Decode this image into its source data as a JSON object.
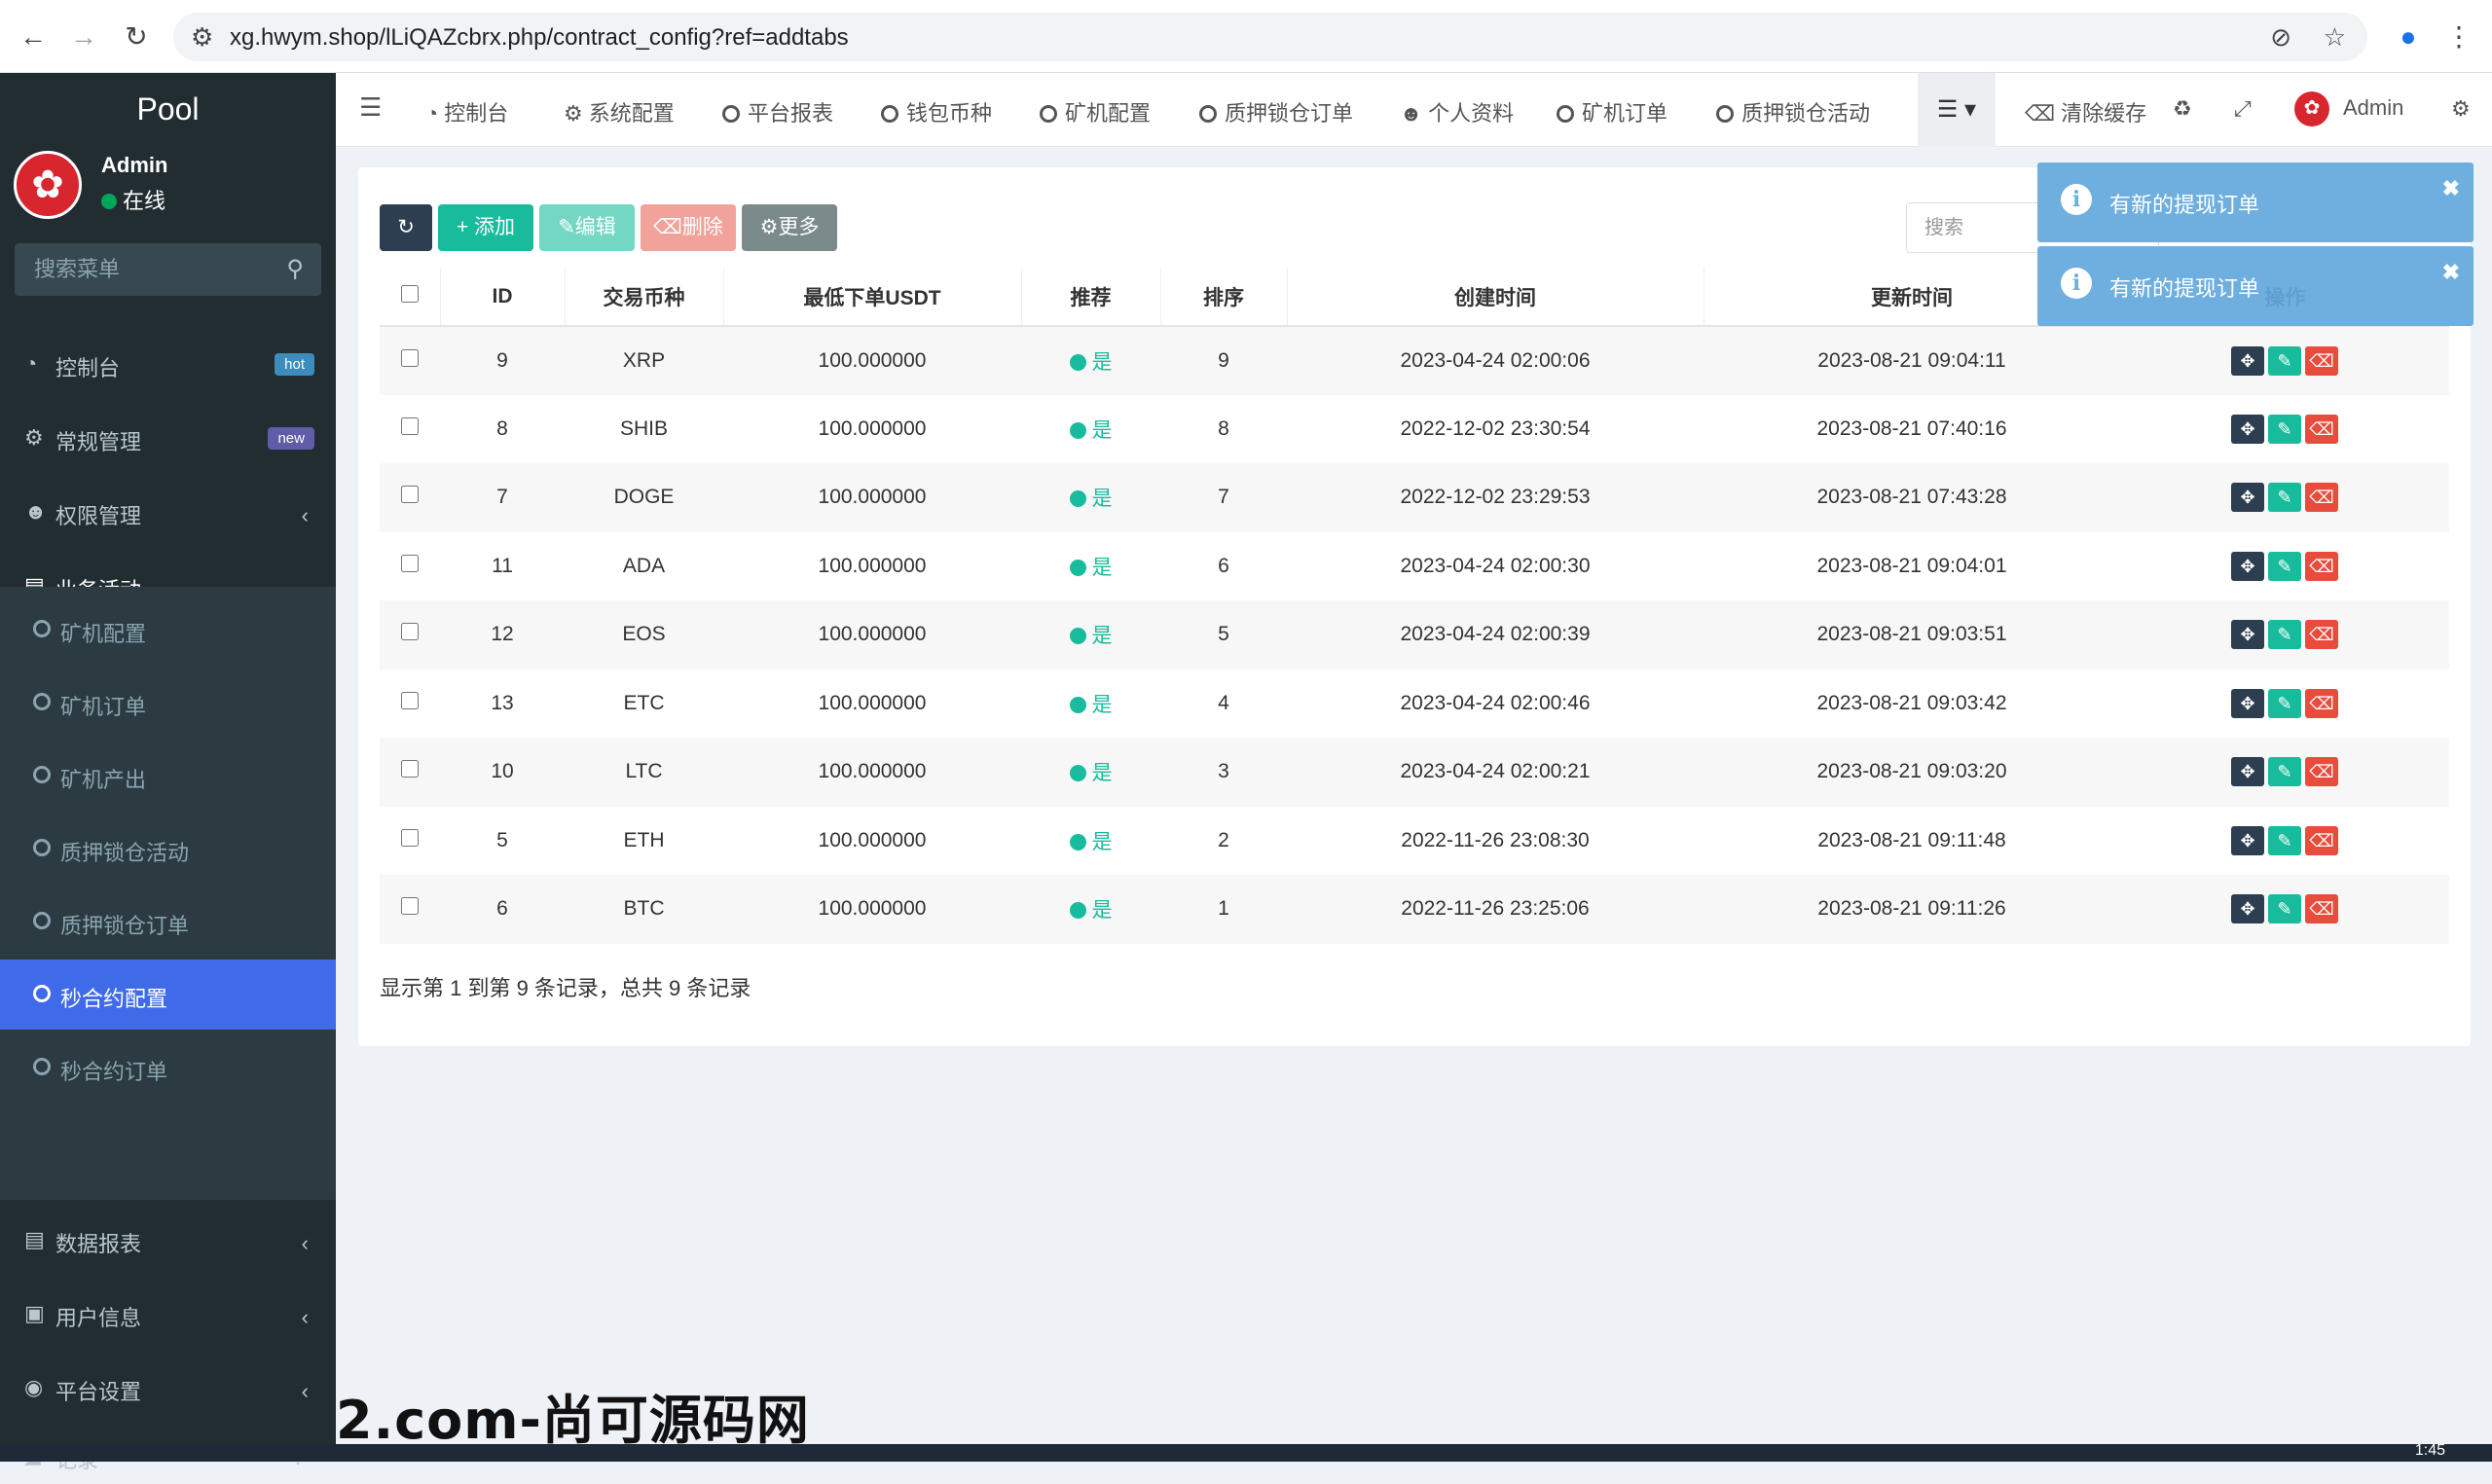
{
  "browser": {
    "url": "xg.hwym.shop/lLiQAZcbrx.php/contract_config?ref=addtabs"
  },
  "sidebar": {
    "logo": "Pool",
    "user": {
      "name": "Admin",
      "status": "在线"
    },
    "search_placeholder": "搜索菜单",
    "menu": [
      {
        "label": "控制台",
        "icon": "dashboard-icon",
        "badge": "hot",
        "badge_color": "#3c8dbc"
      },
      {
        "label": "常规管理",
        "icon": "cogs-icon",
        "badge": "new",
        "badge_color": "#605ca8"
      },
      {
        "label": "权限管理",
        "icon": "group-icon"
      },
      {
        "label": "业务活动",
        "icon": "list-alt-icon"
      }
    ],
    "submenu": [
      {
        "label": "矿机配置"
      },
      {
        "label": "矿机订单"
      },
      {
        "label": "矿机产出"
      },
      {
        "label": "质押锁仓活动"
      },
      {
        "label": "质押锁仓订单"
      },
      {
        "label": "秒合约配置",
        "active": true
      },
      {
        "label": "秒合约订单"
      }
    ],
    "menu_bottom": [
      {
        "label": "数据报表",
        "icon": "file-text-icon"
      },
      {
        "label": "用户信息",
        "icon": "address-book-icon"
      },
      {
        "label": "平台设置",
        "icon": "dot-circle-icon"
      },
      {
        "label": "记录",
        "icon": "area-chart-icon"
      }
    ]
  },
  "topnav": {
    "tabs": [
      "控制台",
      "系统配置",
      "平台报表",
      "钱包币种",
      "矿机配置",
      "质押锁仓订单",
      "个人资料",
      "矿机订单",
      "质押锁仓活动"
    ],
    "clear_cache": "清除缓存",
    "admin": "Admin"
  },
  "toolbar": {
    "add": "添加",
    "edit": "编辑",
    "delete": "删除",
    "more": "更多",
    "search_placeholder": "搜索"
  },
  "table": {
    "headers": [
      "ID",
      "交易币种",
      "最低下单USDT",
      "推荐",
      "排序",
      "创建时间",
      "更新时间",
      "操作"
    ],
    "rows": [
      {
        "id": "9",
        "coin": "XRP",
        "min": "100.000000",
        "rec": "是",
        "sort": "9",
        "created": "2023-04-24 02:00:06",
        "updated": "2023-08-21 09:04:11"
      },
      {
        "id": "8",
        "coin": "SHIB",
        "min": "100.000000",
        "rec": "是",
        "sort": "8",
        "created": "2022-12-02 23:30:54",
        "updated": "2023-08-21 07:40:16"
      },
      {
        "id": "7",
        "coin": "DOGE",
        "min": "100.000000",
        "rec": "是",
        "sort": "7",
        "created": "2022-12-02 23:29:53",
        "updated": "2023-08-21 07:43:28"
      },
      {
        "id": "11",
        "coin": "ADA",
        "min": "100.000000",
        "rec": "是",
        "sort": "6",
        "created": "2023-04-24 02:00:30",
        "updated": "2023-08-21 09:04:01"
      },
      {
        "id": "12",
        "coin": "EOS",
        "min": "100.000000",
        "rec": "是",
        "sort": "5",
        "created": "2023-04-24 02:00:39",
        "updated": "2023-08-21 09:03:51"
      },
      {
        "id": "13",
        "coin": "ETC",
        "min": "100.000000",
        "rec": "是",
        "sort": "4",
        "created": "2023-04-24 02:00:46",
        "updated": "2023-08-21 09:03:42"
      },
      {
        "id": "10",
        "coin": "LTC",
        "min": "100.000000",
        "rec": "是",
        "sort": "3",
        "created": "2023-04-24 02:00:21",
        "updated": "2023-08-21 09:03:20"
      },
      {
        "id": "5",
        "coin": "ETH",
        "min": "100.000000",
        "rec": "是",
        "sort": "2",
        "created": "2022-11-26 23:08:30",
        "updated": "2023-08-21 09:11:48"
      },
      {
        "id": "6",
        "coin": "BTC",
        "min": "100.000000",
        "rec": "是",
        "sort": "1",
        "created": "2022-11-26 23:25:06",
        "updated": "2023-08-21 09:11:26"
      }
    ],
    "pagination": "显示第 1 到第 9 条记录，总共 9 条记录"
  },
  "toasts": [
    "有新的提现订单",
    "有新的提现订单"
  ],
  "watermark": "2.com-尚可源码网",
  "taskbar": {
    "clock": "1:45"
  },
  "colors": {
    "sidebar_bg": "#222d32",
    "active": "#3f6be8",
    "primary": "#18bc9c",
    "danger": "#e74c3c",
    "dark": "#2c3e50",
    "info": "#62a9dd"
  }
}
